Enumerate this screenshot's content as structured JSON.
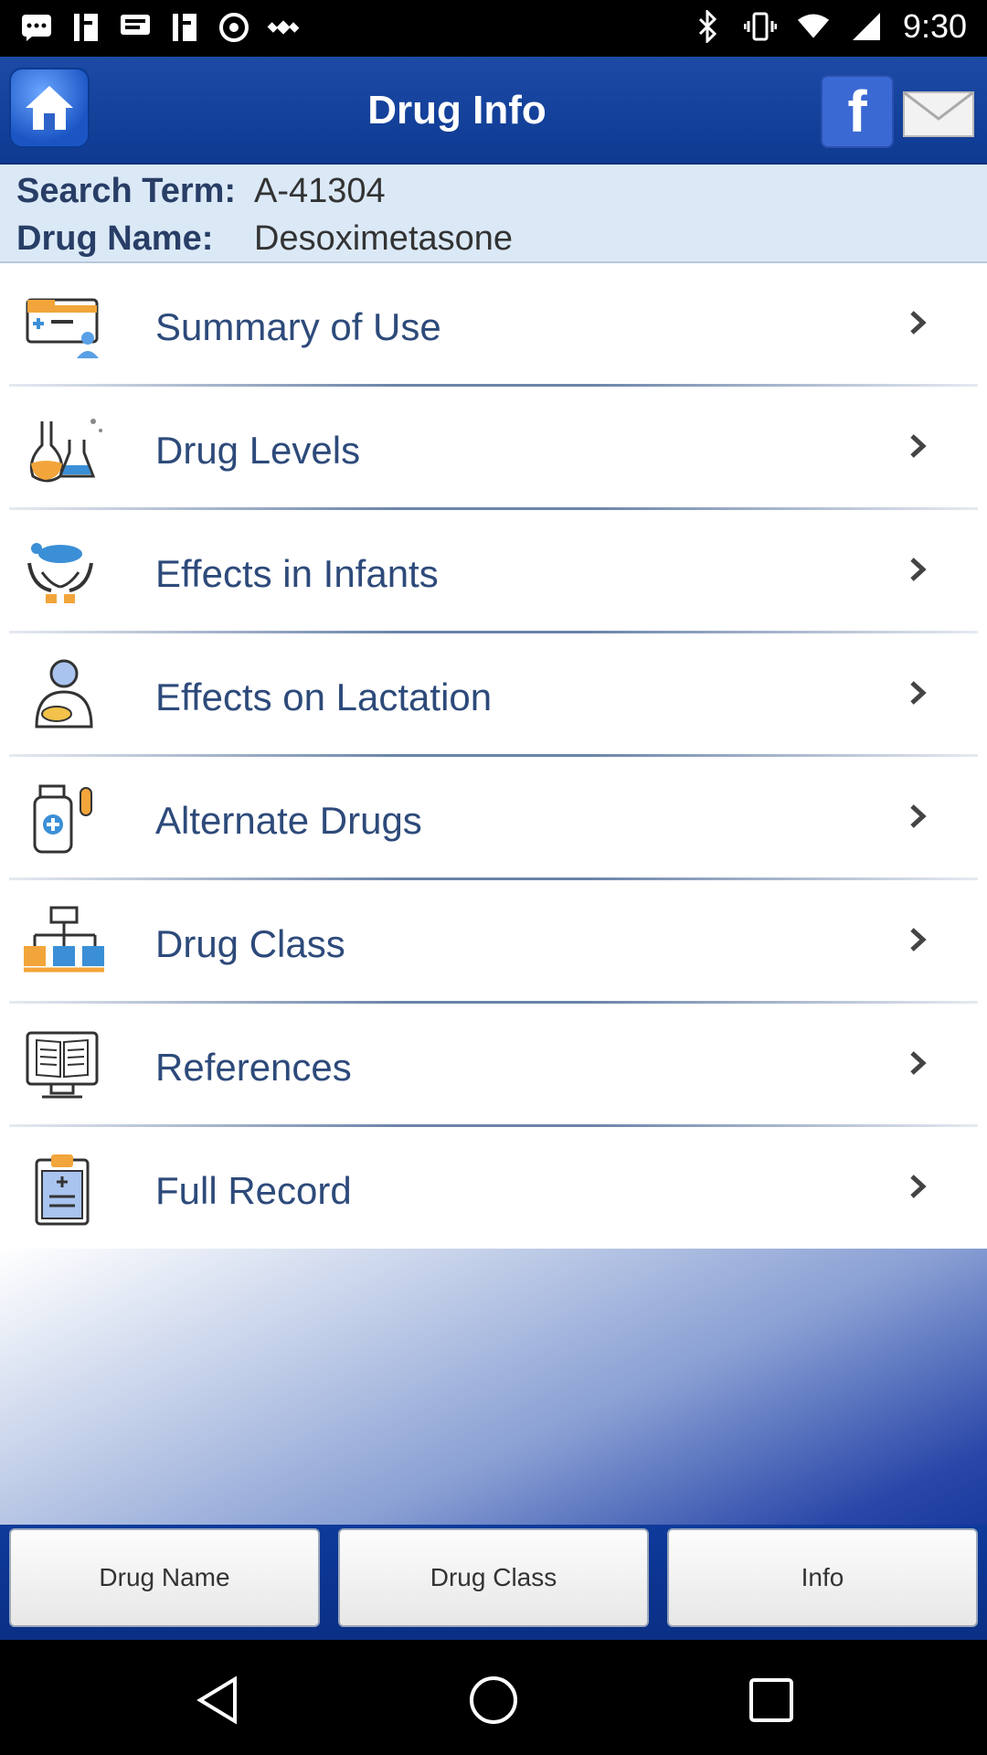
{
  "status_bar": {
    "time": "9:30",
    "icons": [
      "message-icon",
      "fb-notification-icon",
      "cast-icon",
      "fb-notification-icon",
      "timer-icon",
      "satellite-icon",
      "bluetooth-icon",
      "vibrate-icon",
      "wifi-icon",
      "signal-icon"
    ]
  },
  "header": {
    "title": "Drug Info",
    "facebook_letter": "f"
  },
  "search": {
    "term_label": "Search Term:",
    "term_value": "A-41304",
    "name_label": "Drug Name:",
    "name_value": "Desoximetasone"
  },
  "menu": {
    "items": [
      {
        "label": "Summary of Use",
        "icon": "summary-icon"
      },
      {
        "label": "Drug Levels",
        "icon": "flask-icon"
      },
      {
        "label": "Effects in Infants",
        "icon": "infant-hands-icon"
      },
      {
        "label": "Effects on Lactation",
        "icon": "mother-baby-icon"
      },
      {
        "label": "Alternate Drugs",
        "icon": "medicine-bottle-icon"
      },
      {
        "label": "Drug Class",
        "icon": "hierarchy-icon"
      },
      {
        "label": "References",
        "icon": "book-monitor-icon"
      },
      {
        "label": "Full Record",
        "icon": "clipboard-icon"
      }
    ]
  },
  "tabs": {
    "drug_name": "Drug Name",
    "drug_class": "Drug Class",
    "info": "Info"
  },
  "colors": {
    "header_blue": "#1c4aa5",
    "info_bg": "#dbe9f7",
    "label_text": "#2d4a7a"
  }
}
